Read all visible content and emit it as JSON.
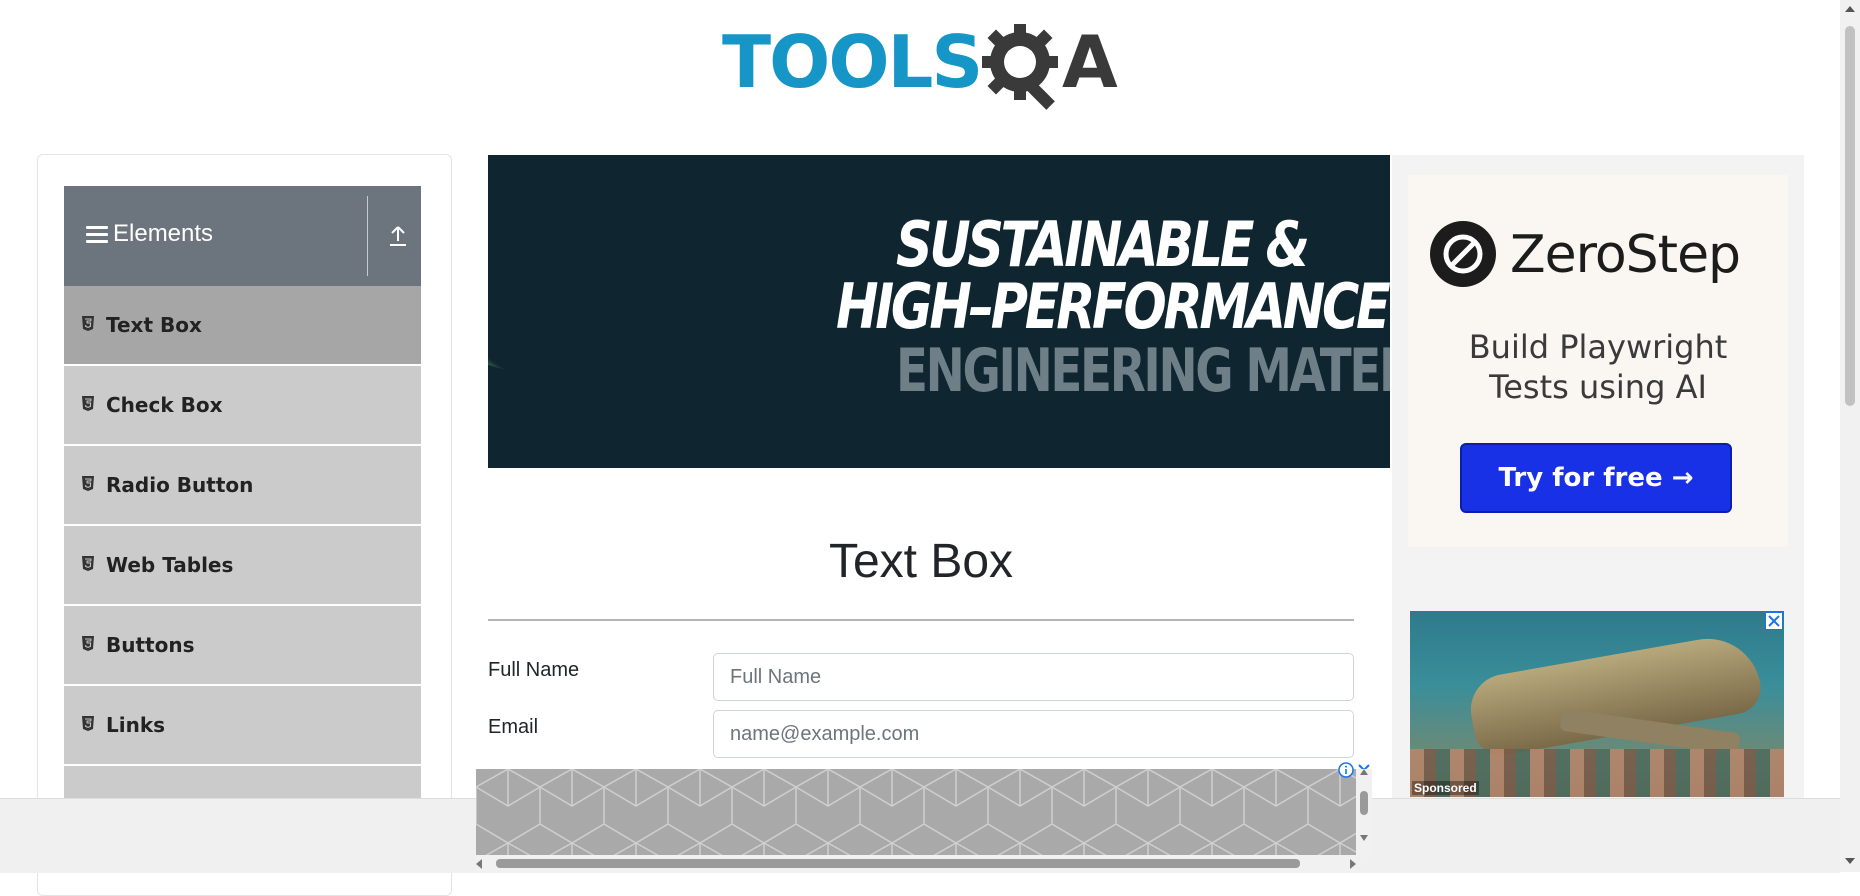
{
  "header": {
    "logo_text": "TOOLS",
    "logo_tail": "A",
    "logo_full": "TOOLSQA"
  },
  "sidebar": {
    "group_title": "Elements",
    "items": [
      {
        "label": "Text Box",
        "active": true
      },
      {
        "label": "Check Box",
        "active": false
      },
      {
        "label": "Radio Button",
        "active": false
      },
      {
        "label": "Web Tables",
        "active": false
      },
      {
        "label": "Buttons",
        "active": false
      },
      {
        "label": "Links",
        "active": false
      }
    ]
  },
  "banner": {
    "line1": "SUSTAINABLE &",
    "line2": "HIGH–PERFORMANCE",
    "line3": "ENGINEERING MATERIA"
  },
  "main": {
    "title": "Text Box",
    "fields": {
      "full_name": {
        "label": "Full Name",
        "placeholder": "Full Name",
        "value": ""
      },
      "email": {
        "label": "Email",
        "placeholder": "name@example.com",
        "value": ""
      }
    }
  },
  "right_ad": {
    "brand": "ZeroStep",
    "subtitle_line1": "Build Playwright",
    "subtitle_line2": "Tests using AI",
    "cta": "Try for free →",
    "sponsored_label": "Sponsored"
  },
  "colors": {
    "logo_blue": "#1696c7",
    "sidebar_header": "#6c757d",
    "menu_active": "#a6a6a6",
    "menu_item": "#cbcbcb",
    "cta_blue": "#1831e6",
    "banner_bg": "#0f2530"
  }
}
